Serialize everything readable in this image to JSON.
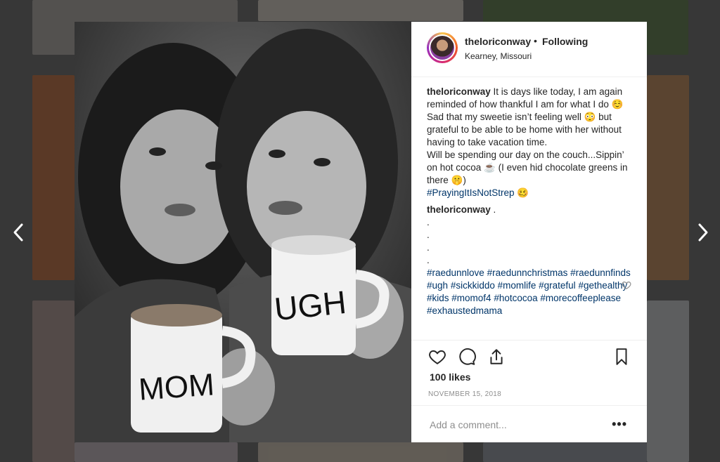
{
  "post": {
    "username": "theloriconway",
    "dot": "•",
    "follow_label": "Following",
    "location": "Kearney, Missouri",
    "caption_username": "theloriconway",
    "caption_line1": "It is days like today, I am again reminded of how thankful I am for what I do ☺️ Sad that my sweetie isn’t feeling well 😳 but grateful to be able to be home with her without having to take vacation time.",
    "caption_line2": "Will be spending our day on the couch...Sippin’ on hot cocoa ☕ (I even hid chocolate greens in there 🤫)",
    "caption_tag": "#PrayingItIsNotStrep",
    "caption_tag_emoji": "🥴",
    "comment_username": "theloriconway",
    "comment_dot": ".",
    "dots": [
      ".",
      ".",
      ".",
      "."
    ],
    "hashtags": [
      "#raedunnlove",
      "#raedunnchristmas",
      "#raedunnfinds",
      "#ugh",
      "#sickkiddo",
      "#momlife",
      "#grateful",
      "#gethealthy",
      "#kids",
      "#momof4",
      "#hotcocoa",
      "#morecoffeeplease",
      "#exhaustedmama"
    ],
    "likes": "100 likes",
    "date": "November 15, 2018",
    "comment_placeholder": "Add a comment...",
    "more_label": "•••"
  },
  "photo": {
    "mug_left": "MOM",
    "mug_right": "UGH"
  },
  "icons": {
    "prev": "chevron-left-icon",
    "next": "chevron-right-icon",
    "like": "heart-icon",
    "comment": "comment-icon",
    "share": "share-icon",
    "save": "bookmark-icon"
  },
  "colors": {
    "hashtag": "#003569",
    "text": "#262626",
    "muted": "#8e8e8e"
  }
}
